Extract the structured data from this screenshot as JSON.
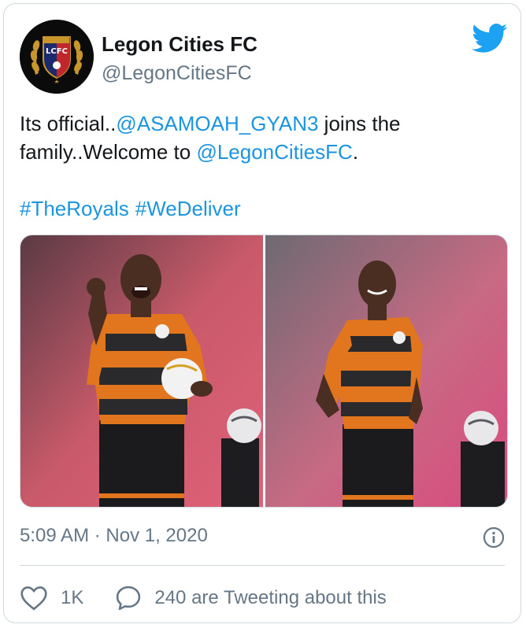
{
  "tweet": {
    "account": {
      "display_name": "Legon Cities FC",
      "handle": "@LegonCitiesFC",
      "avatar_icon": "club-crest-icon",
      "avatar_text": "LCFC"
    },
    "text": {
      "part1": "Its official..",
      "mention1": "@ASAMOAH_GYAN3",
      "part2": " joins the family..Welcome to ",
      "mention2": "@LegonCitiesFC",
      "part3": "."
    },
    "hashtags": [
      "#TheRoyals",
      "#WeDeliver"
    ],
    "media": [
      {
        "description_icon": "photo-player-celebrating"
      },
      {
        "description_icon": "photo-player-posing"
      }
    ],
    "timestamp": "5:09 AM · Nov 1, 2020",
    "likes": "1K",
    "conversation": "240 are Tweeting about this"
  },
  "colors": {
    "link": "#1b95e0",
    "muted": "#657786",
    "border": "#cfd9de",
    "twitter_blue": "#1da1f2"
  }
}
